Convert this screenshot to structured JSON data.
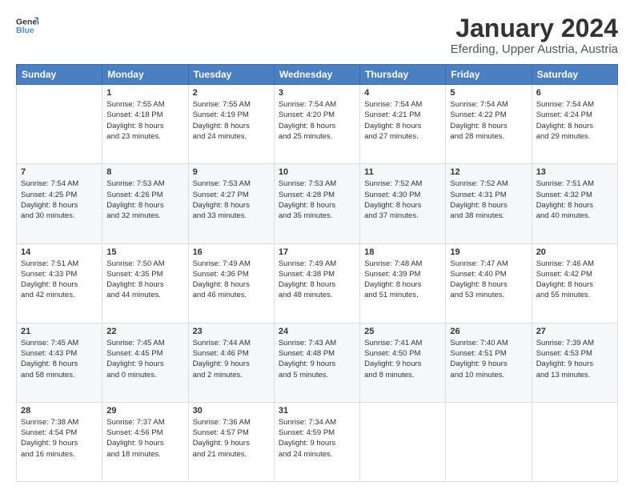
{
  "logo": {
    "line1": "General",
    "line2": "Blue"
  },
  "title": "January 2024",
  "subtitle": "Eferding, Upper Austria, Austria",
  "weekdays": [
    "Sunday",
    "Monday",
    "Tuesday",
    "Wednesday",
    "Thursday",
    "Friday",
    "Saturday"
  ],
  "weeks": [
    [
      {
        "day": "",
        "info": ""
      },
      {
        "day": "1",
        "info": "Sunrise: 7:55 AM\nSunset: 4:18 PM\nDaylight: 8 hours\nand 23 minutes."
      },
      {
        "day": "2",
        "info": "Sunrise: 7:55 AM\nSunset: 4:19 PM\nDaylight: 8 hours\nand 24 minutes."
      },
      {
        "day": "3",
        "info": "Sunrise: 7:54 AM\nSunset: 4:20 PM\nDaylight: 8 hours\nand 25 minutes."
      },
      {
        "day": "4",
        "info": "Sunrise: 7:54 AM\nSunset: 4:21 PM\nDaylight: 8 hours\nand 27 minutes."
      },
      {
        "day": "5",
        "info": "Sunrise: 7:54 AM\nSunset: 4:22 PM\nDaylight: 8 hours\nand 28 minutes."
      },
      {
        "day": "6",
        "info": "Sunrise: 7:54 AM\nSunset: 4:24 PM\nDaylight: 8 hours\nand 29 minutes."
      }
    ],
    [
      {
        "day": "7",
        "info": "Sunrise: 7:54 AM\nSunset: 4:25 PM\nDaylight: 8 hours\nand 30 minutes."
      },
      {
        "day": "8",
        "info": "Sunrise: 7:53 AM\nSunset: 4:26 PM\nDaylight: 8 hours\nand 32 minutes."
      },
      {
        "day": "9",
        "info": "Sunrise: 7:53 AM\nSunset: 4:27 PM\nDaylight: 8 hours\nand 33 minutes."
      },
      {
        "day": "10",
        "info": "Sunrise: 7:53 AM\nSunset: 4:28 PM\nDaylight: 8 hours\nand 35 minutes."
      },
      {
        "day": "11",
        "info": "Sunrise: 7:52 AM\nSunset: 4:30 PM\nDaylight: 8 hours\nand 37 minutes."
      },
      {
        "day": "12",
        "info": "Sunrise: 7:52 AM\nSunset: 4:31 PM\nDaylight: 8 hours\nand 38 minutes."
      },
      {
        "day": "13",
        "info": "Sunrise: 7:51 AM\nSunset: 4:32 PM\nDaylight: 8 hours\nand 40 minutes."
      }
    ],
    [
      {
        "day": "14",
        "info": "Sunrise: 7:51 AM\nSunset: 4:33 PM\nDaylight: 8 hours\nand 42 minutes."
      },
      {
        "day": "15",
        "info": "Sunrise: 7:50 AM\nSunset: 4:35 PM\nDaylight: 8 hours\nand 44 minutes."
      },
      {
        "day": "16",
        "info": "Sunrise: 7:49 AM\nSunset: 4:36 PM\nDaylight: 8 hours\nand 46 minutes."
      },
      {
        "day": "17",
        "info": "Sunrise: 7:49 AM\nSunset: 4:38 PM\nDaylight: 8 hours\nand 48 minutes."
      },
      {
        "day": "18",
        "info": "Sunrise: 7:48 AM\nSunset: 4:39 PM\nDaylight: 8 hours\nand 51 minutes."
      },
      {
        "day": "19",
        "info": "Sunrise: 7:47 AM\nSunset: 4:40 PM\nDaylight: 8 hours\nand 53 minutes."
      },
      {
        "day": "20",
        "info": "Sunrise: 7:46 AM\nSunset: 4:42 PM\nDaylight: 8 hours\nand 55 minutes."
      }
    ],
    [
      {
        "day": "21",
        "info": "Sunrise: 7:45 AM\nSunset: 4:43 PM\nDaylight: 8 hours\nand 58 minutes."
      },
      {
        "day": "22",
        "info": "Sunrise: 7:45 AM\nSunset: 4:45 PM\nDaylight: 9 hours\nand 0 minutes."
      },
      {
        "day": "23",
        "info": "Sunrise: 7:44 AM\nSunset: 4:46 PM\nDaylight: 9 hours\nand 2 minutes."
      },
      {
        "day": "24",
        "info": "Sunrise: 7:43 AM\nSunset: 4:48 PM\nDaylight: 9 hours\nand 5 minutes."
      },
      {
        "day": "25",
        "info": "Sunrise: 7:41 AM\nSunset: 4:50 PM\nDaylight: 9 hours\nand 8 minutes."
      },
      {
        "day": "26",
        "info": "Sunrise: 7:40 AM\nSunset: 4:51 PM\nDaylight: 9 hours\nand 10 minutes."
      },
      {
        "day": "27",
        "info": "Sunrise: 7:39 AM\nSunset: 4:53 PM\nDaylight: 9 hours\nand 13 minutes."
      }
    ],
    [
      {
        "day": "28",
        "info": "Sunrise: 7:38 AM\nSunset: 4:54 PM\nDaylight: 9 hours\nand 16 minutes."
      },
      {
        "day": "29",
        "info": "Sunrise: 7:37 AM\nSunset: 4:56 PM\nDaylight: 9 hours\nand 18 minutes."
      },
      {
        "day": "30",
        "info": "Sunrise: 7:36 AM\nSunset: 4:57 PM\nDaylight: 9 hours\nand 21 minutes."
      },
      {
        "day": "31",
        "info": "Sunrise: 7:34 AM\nSunset: 4:59 PM\nDaylight: 9 hours\nand 24 minutes."
      },
      {
        "day": "",
        "info": ""
      },
      {
        "day": "",
        "info": ""
      },
      {
        "day": "",
        "info": ""
      }
    ]
  ]
}
